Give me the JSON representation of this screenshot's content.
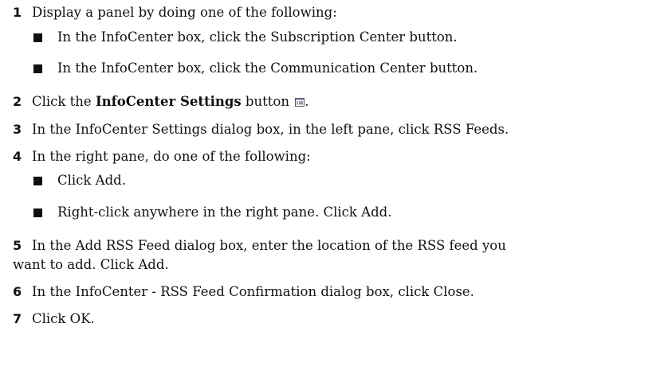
{
  "steps": [
    {
      "num": "1",
      "text": "Display a panel by doing one of the following:"
    },
    {
      "num": "2",
      "text_before": "Click the ",
      "bold": "InfoCenter Settings",
      "text_after": " button",
      "text_end": "."
    },
    {
      "num": "3",
      "text": "In the InfoCenter Settings dialog box, in the left pane, click RSS Feeds."
    },
    {
      "num": "4",
      "text": "In the right pane, do one of the following:"
    },
    {
      "num": "5",
      "text_line1": "In the Add RSS Feed dialog box, enter the location of the RSS feed you",
      "text_line2": "want to add. Click Add."
    },
    {
      "num": "6",
      "text": "In the InfoCenter - RSS Feed Confirmation dialog box, click Close."
    },
    {
      "num": "7",
      "text": "Click OK."
    }
  ],
  "step1_options": [
    "In the InfoCenter box, click the Subscription Center button.",
    "In the InfoCenter box, click the Communication Center button."
  ],
  "step4_options": [
    "Click Add.",
    "Right-click anywhere in the right pane. Click Add."
  ],
  "icons": {
    "settings_button_icon": "infocenter-settings-icon"
  }
}
